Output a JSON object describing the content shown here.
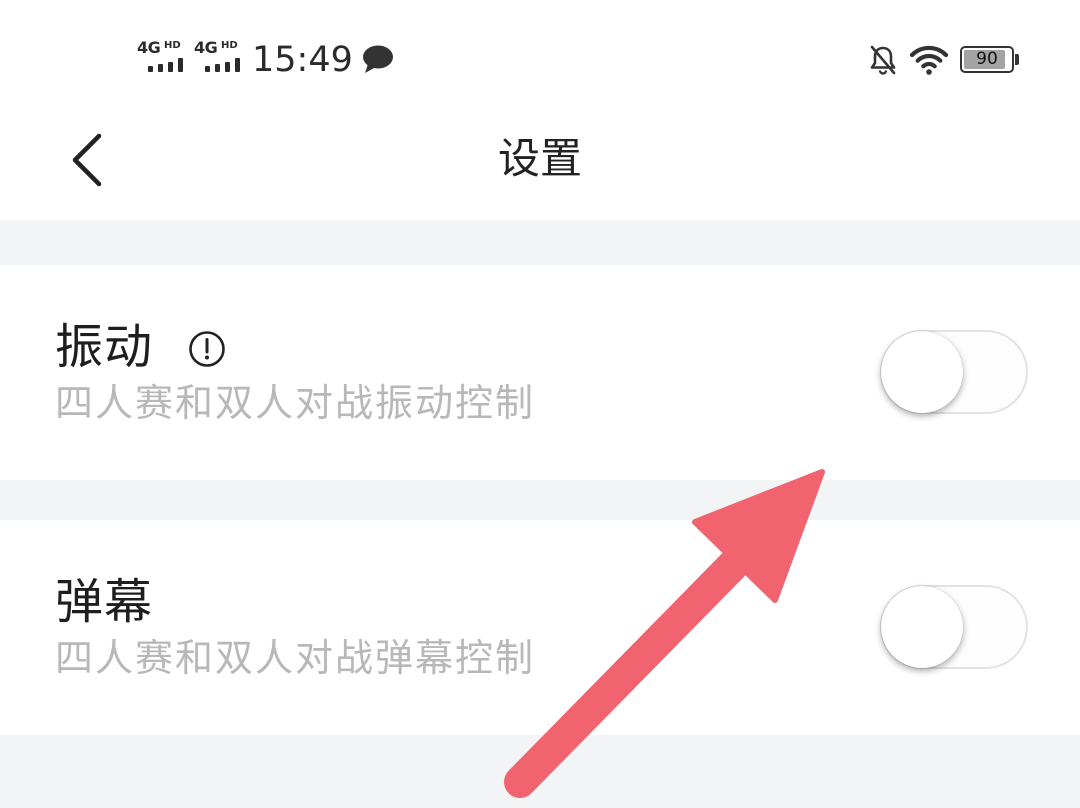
{
  "status_bar": {
    "sim_slots": [
      {
        "network": "4G",
        "badge": "HD"
      },
      {
        "network": "4G",
        "badge": "HD"
      }
    ],
    "time": "15:49",
    "notification_icons": [
      "chat-bubble-icon"
    ],
    "system_icons": [
      "bell-off-icon",
      "wifi-icon"
    ],
    "battery_level": "90"
  },
  "header": {
    "back_icon": "chevron-left-icon",
    "title": "设置"
  },
  "settings": [
    {
      "title": "振动",
      "subtitle": "四人赛和双人对战振动控制",
      "info_icon": "info-circle-icon",
      "enabled": false
    },
    {
      "title": "弹幕",
      "subtitle": "四人赛和双人对战弹幕控制",
      "enabled": false
    }
  ],
  "annotation": {
    "icon": "arrow-pointer-icon"
  },
  "colors": {
    "page_background": "#f3f4f6",
    "card_background": "#ffffff",
    "primary_text": "#1e1e1e",
    "secondary_text": "#b8b8b8",
    "toggle_border": "#e3e3e3",
    "annotation_arrow": "#f1636f"
  }
}
